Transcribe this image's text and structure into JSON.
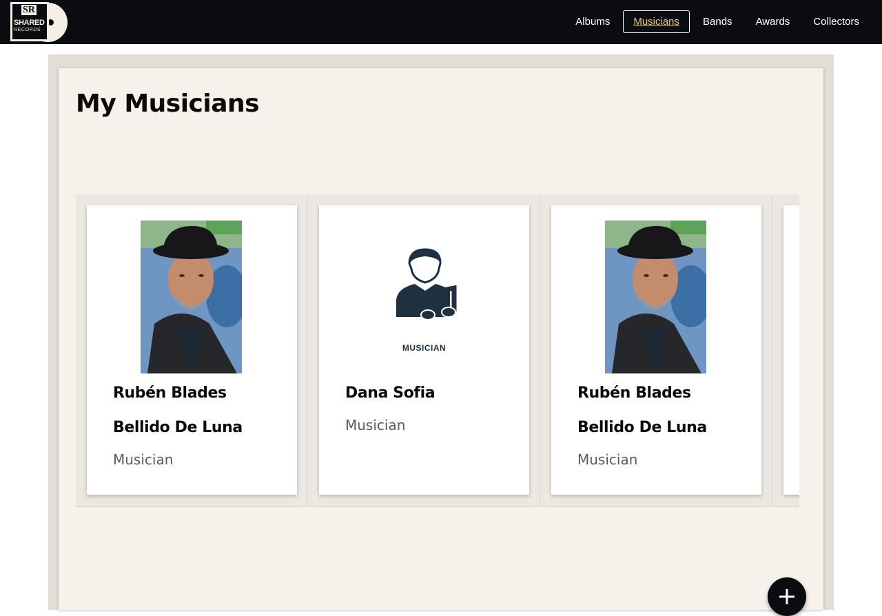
{
  "navbar": {
    "logo": {
      "mark": "SR",
      "name": "SHARED",
      "sub": "RECORDS"
    },
    "links": [
      {
        "label": "Albums",
        "active": false
      },
      {
        "label": "Musicians",
        "active": true
      },
      {
        "label": "Bands",
        "active": false
      },
      {
        "label": "Awards",
        "active": false
      },
      {
        "label": "Collectors",
        "active": false
      }
    ]
  },
  "page": {
    "title": "My Musicians"
  },
  "musicians": [
    {
      "name": "Rubén Blades Bellido De Luna",
      "role": "Musician",
      "image": "photo"
    },
    {
      "name": "Dana Sofia",
      "role": "Musician",
      "image": "placeholder",
      "placeholder_label": "MUSICIAN"
    },
    {
      "name": "Rubén Blades Bellido De Luna",
      "role": "Musician",
      "image": "photo"
    }
  ],
  "fab": {
    "icon": "plus-icon"
  },
  "colors": {
    "navbar": "#0b0c10",
    "active_link": "#f0c878",
    "panel": "#f6f1eb",
    "page_bg": "#e2ddd6",
    "placeholder_icon": "#1f3140"
  }
}
